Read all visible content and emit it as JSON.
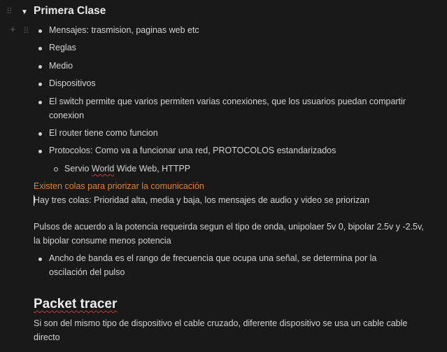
{
  "heading_toggle": {
    "title": "Primera Clase",
    "arrow": "▼"
  },
  "bullets": [
    "Mensajes: trasmision, paginas web etc",
    "Reglas",
    "Medio",
    "Dispositivos",
    "El switch permite que varios permiten varias conexiones, que los usuarios puedan compartir conexion",
    "El router tiene como funcion",
    "Protocolos: Como va a funcionar una red, PROTOCOLOS estandarizados"
  ],
  "sub_bullet": {
    "before": "Servio ",
    "squiggle": "World",
    "after": " Wide Web, HTTPP"
  },
  "callout_text": "Existen colas para priorizar la comunicación",
  "paragraph_1": "Hay tres colas: Prioridad alta, media y baja, los mensajes de audio y video se priorizan",
  "paragraph_2": "Pulsos de acuerdo a la potencia requeirda segun el tipo de onda, unipolaer 5v 0, bipolar 2.5v y -2.5v, la bipolar consume menos potencia",
  "bullet_after": "Ancho de banda es el rango de frecuencia que ocupa una señal, se determina por la oscilación del pulso",
  "heading_2": "Packet tracer",
  "paragraph_3": "Si son del mismo tipo de dispositivo el cable cruzado, diferente dispositivo se usa un cable cable directo",
  "icons": {
    "drag": "⠿",
    "plus": "+"
  }
}
